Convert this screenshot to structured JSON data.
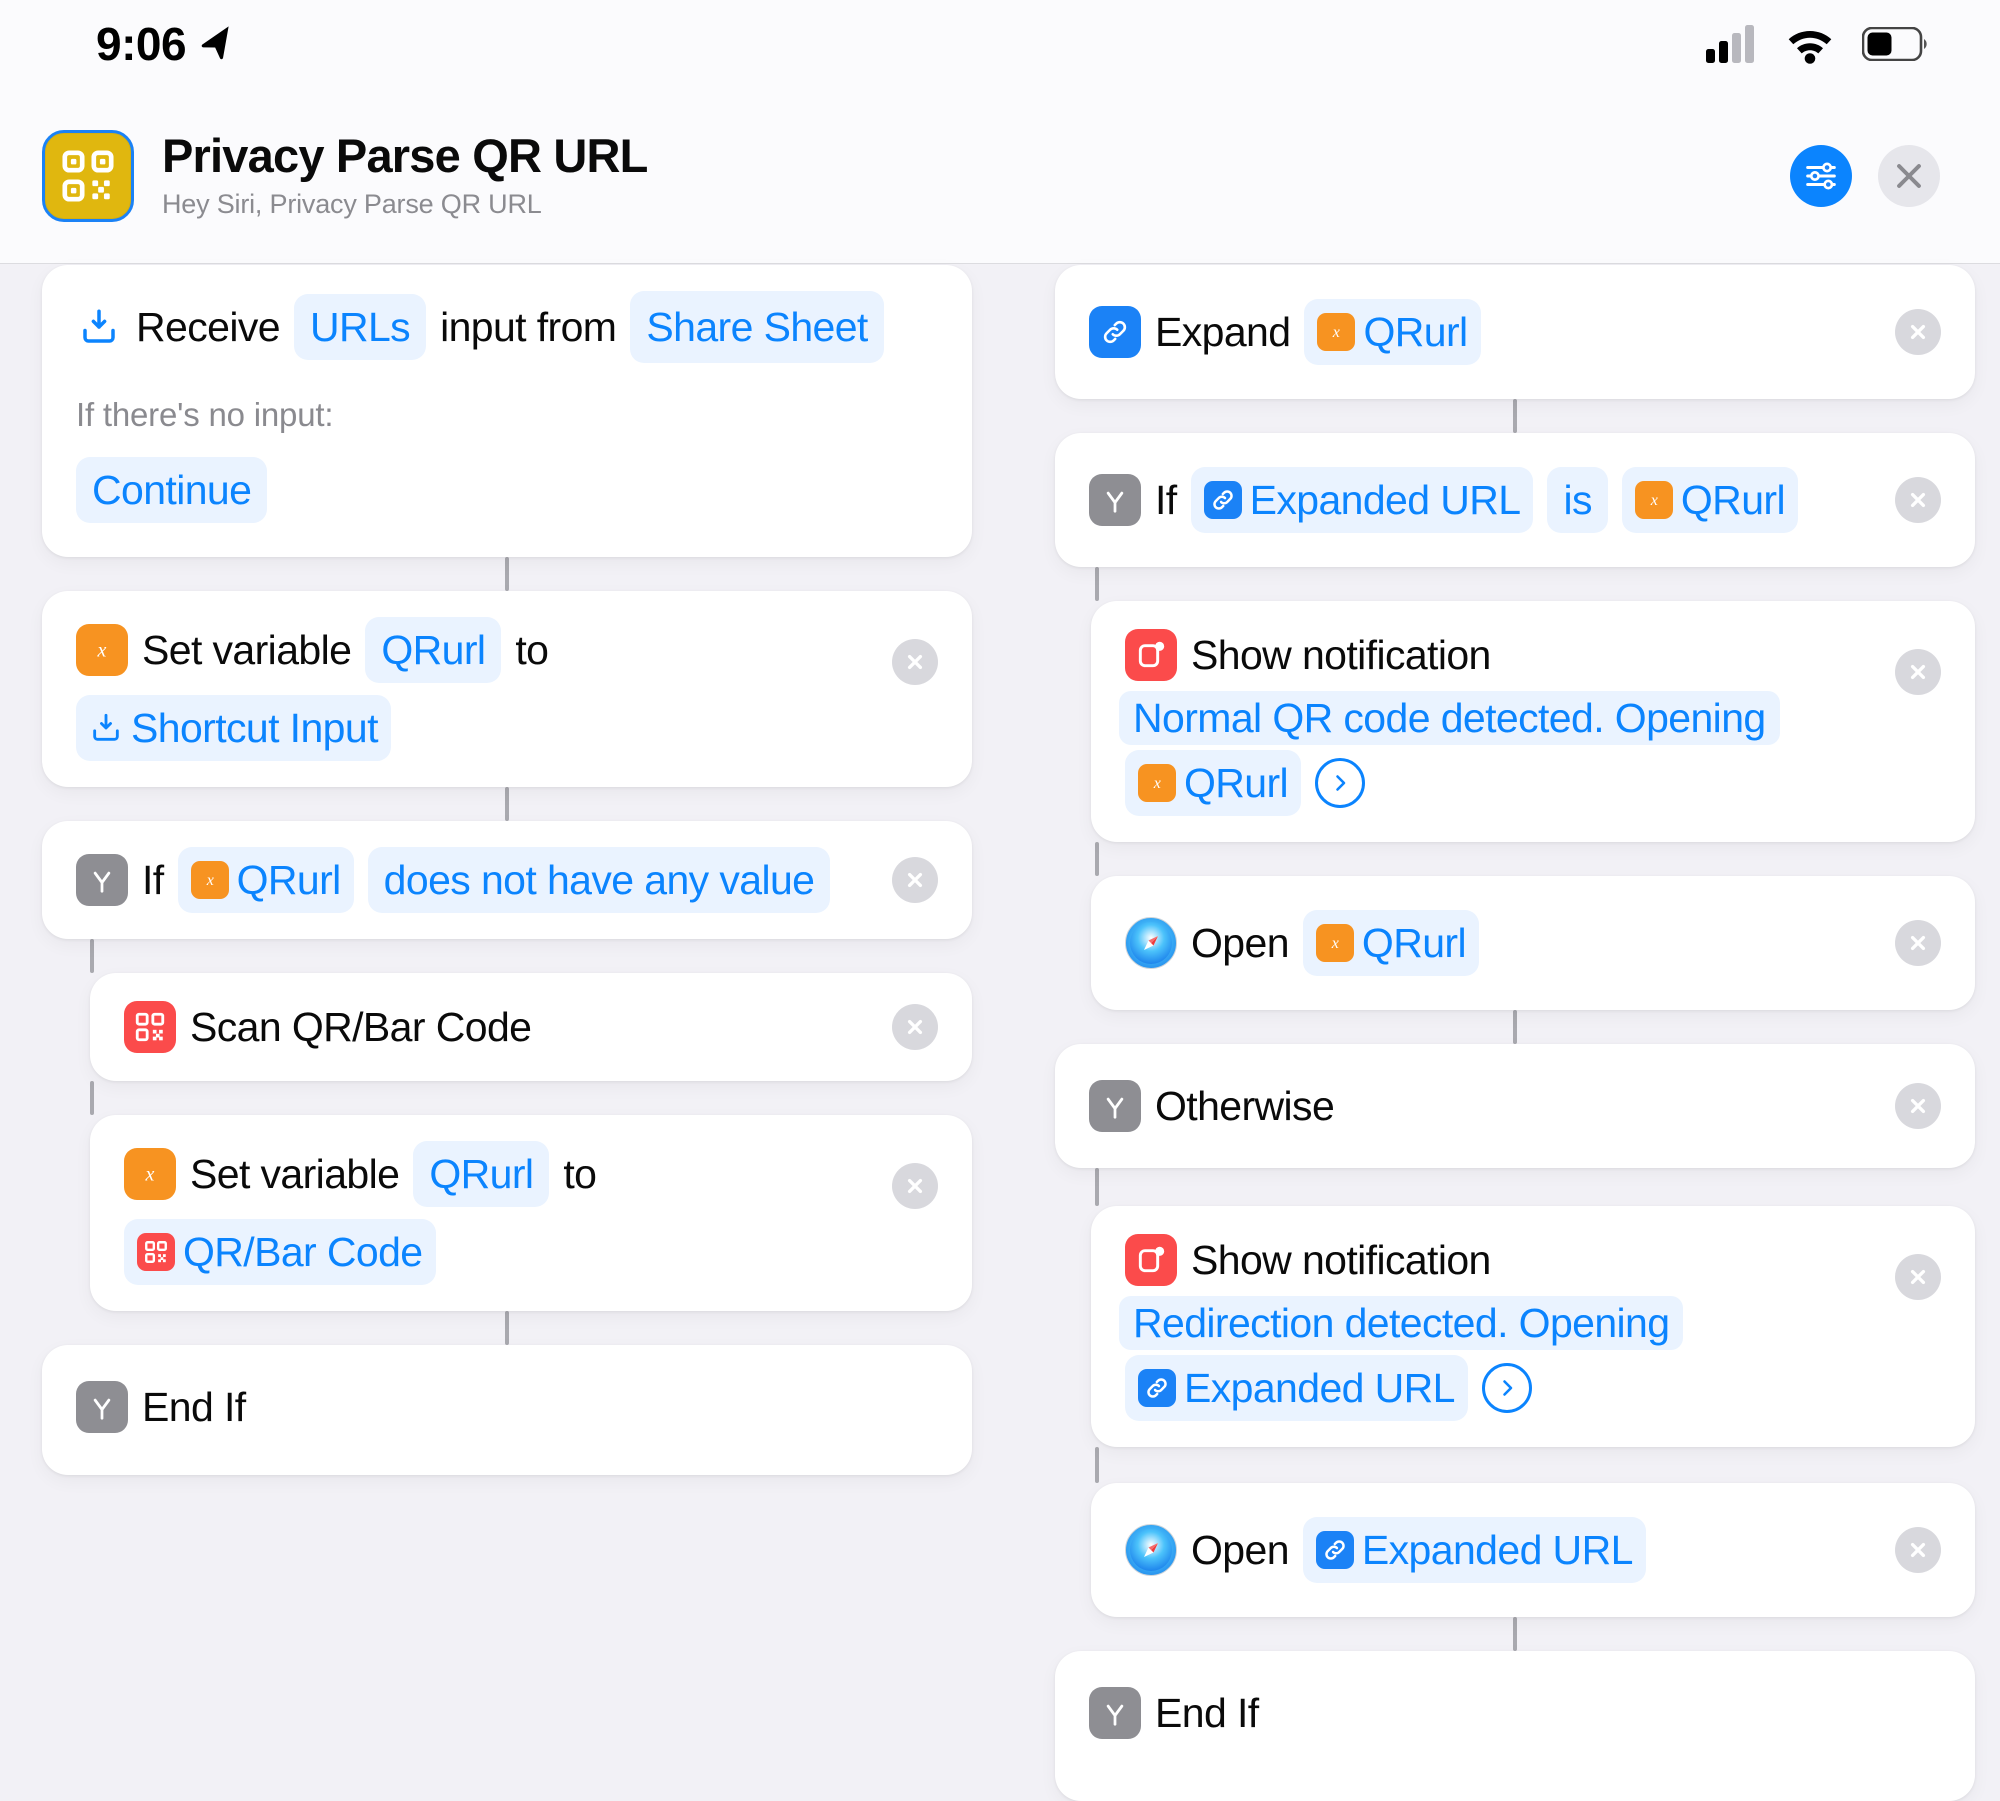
{
  "status_bar": {
    "time": "9:06",
    "location_icon": "location-arrow-icon",
    "cellular_icon": "cellular-signal-icon",
    "wifi_icon": "wifi-icon",
    "battery_icon": "battery-icon"
  },
  "header": {
    "icon_name": "qr-code-app-icon",
    "title": "Privacy Parse QR URL",
    "subtitle": "Hey Siri, Privacy Parse QR URL",
    "settings_button": "settings-sliders-icon",
    "close_button": "close-icon"
  },
  "colors": {
    "accent_blue": "#0b84fe",
    "pill_bg": "#eaf3ff",
    "orange": "#f79321",
    "red": "#fb4b4b",
    "gray": "#8e8e93",
    "app_icon_yellow": "#e0b70f",
    "canvas_bg": "#f2f1f6"
  },
  "left_column": {
    "receive": {
      "icon": "share-input-icon",
      "word_receive": "Receive",
      "pill_urls": "URLs",
      "word_input_from": "input from",
      "pill_share_sheet": "Share Sheet",
      "no_input_label": "If there's no input:",
      "pill_continue": "Continue"
    },
    "set_var_1": {
      "icon": "variable-x-icon",
      "word_set_variable": "Set variable",
      "pill_varname": "QRurl",
      "word_to": "to",
      "pill_value_icon": "share-input-icon",
      "pill_value": "Shortcut Input",
      "remove": "remove-action-icon"
    },
    "if_1": {
      "icon": "if-branch-icon",
      "word_if": "If",
      "pill_var_icon": "variable-x-icon",
      "pill_var": "QRurl",
      "pill_condition": "does not have any value",
      "remove": "remove-action-icon"
    },
    "scan": {
      "icon": "qr-scan-icon",
      "label": "Scan QR/Bar Code",
      "remove": "remove-action-icon"
    },
    "set_var_2": {
      "icon": "variable-x-icon",
      "word_set_variable": "Set variable",
      "pill_varname": "QRurl",
      "word_to": "to",
      "pill_value_icon": "qr-scan-icon",
      "pill_value": "QR/Bar Code",
      "remove": "remove-action-icon"
    },
    "end_if": {
      "icon": "if-branch-icon",
      "label": "End If"
    }
  },
  "right_column": {
    "expand": {
      "icon": "link-icon",
      "word_expand": "Expand",
      "pill_var_icon": "variable-x-icon",
      "pill_var": "QRurl",
      "remove": "remove-action-icon"
    },
    "if_2": {
      "icon": "if-branch-icon",
      "word_if": "If",
      "pill_a_icon": "link-icon",
      "pill_a": "Expanded URL",
      "pill_operator": "is",
      "pill_b_icon": "variable-x-icon",
      "pill_b": "QRurl",
      "remove": "remove-action-icon"
    },
    "notify_1": {
      "icon": "notification-icon",
      "word_show_notification": "Show notification",
      "text_part_1": "Normal QR code detected. Opening",
      "pill_var_icon": "variable-x-icon",
      "pill_var": "QRurl",
      "chevron": "chevron-right-icon",
      "remove": "remove-action-icon"
    },
    "open_1": {
      "icon": "safari-icon",
      "word_open": "Open",
      "pill_var_icon": "variable-x-icon",
      "pill_var": "QRurl",
      "remove": "remove-action-icon"
    },
    "otherwise": {
      "icon": "if-branch-icon",
      "label": "Otherwise",
      "remove": "remove-action-icon"
    },
    "notify_2": {
      "icon": "notification-icon",
      "word_show_notification": "Show notification",
      "text_part_1": "Redirection detected. Opening",
      "pill_var_icon": "link-icon",
      "pill_var": "Expanded URL",
      "chevron": "chevron-right-icon",
      "remove": "remove-action-icon"
    },
    "open_2": {
      "icon": "safari-icon",
      "word_open": "Open",
      "pill_var_icon": "link-icon",
      "pill_var": "Expanded URL",
      "remove": "remove-action-icon"
    },
    "end_if": {
      "icon": "if-branch-icon",
      "label": "End If"
    }
  }
}
